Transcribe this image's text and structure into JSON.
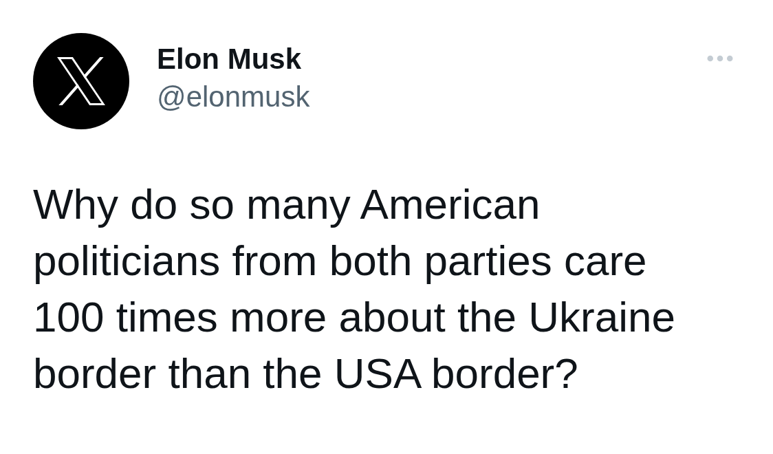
{
  "tweet": {
    "author": {
      "name": "Elon Musk",
      "handle": "@elonmusk"
    },
    "text": "Why do so many American politicians from both parties care 100 times more about the Ukraine border than the USA border?"
  }
}
